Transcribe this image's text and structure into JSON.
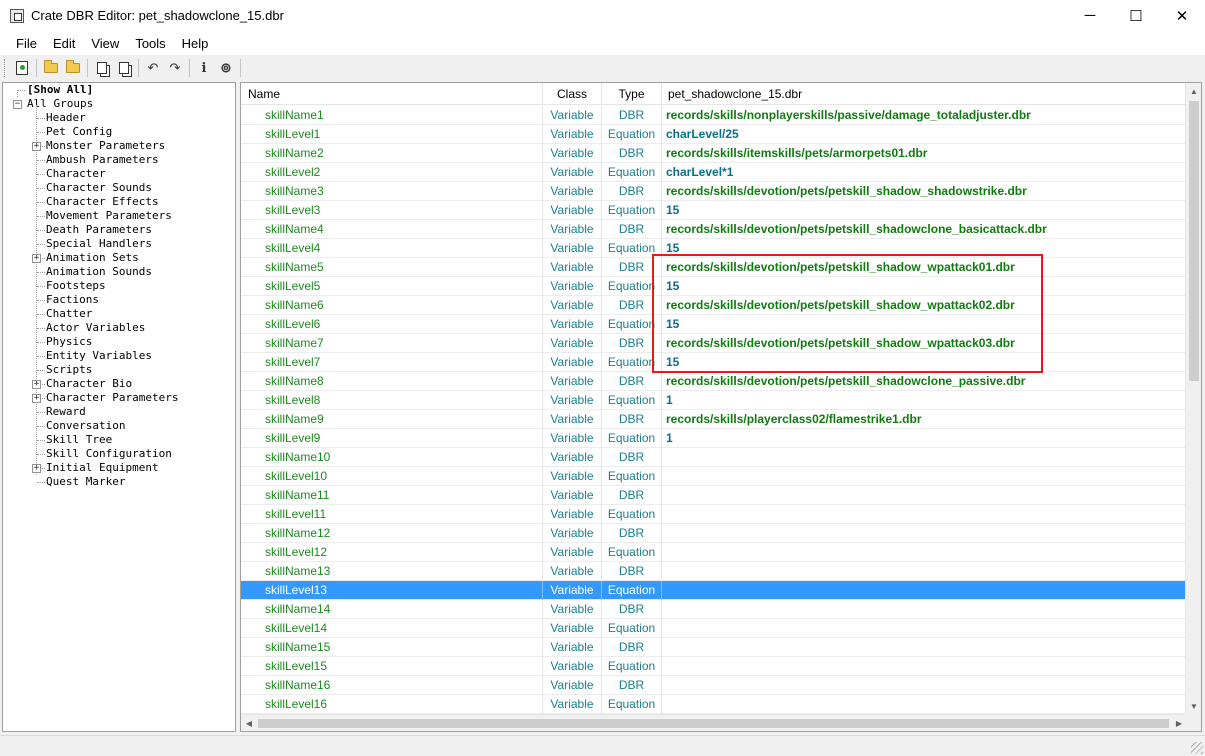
{
  "window": {
    "title": "Crate DBR Editor: pet_shadowclone_15.dbr",
    "minimize": "─",
    "maximize": "☐",
    "close": "✕"
  },
  "menu": [
    "File",
    "Edit",
    "View",
    "Tools",
    "Help"
  ],
  "tree": {
    "show_all": "[Show All]",
    "root": "All Groups",
    "items": [
      {
        "label": "Header",
        "expandable": false
      },
      {
        "label": "Pet Config",
        "expandable": false
      },
      {
        "label": "Monster Parameters",
        "expandable": true
      },
      {
        "label": "Ambush Parameters",
        "expandable": false
      },
      {
        "label": "Character",
        "expandable": false
      },
      {
        "label": "Character Sounds",
        "expandable": false
      },
      {
        "label": "Character Effects",
        "expandable": false
      },
      {
        "label": "Movement Parameters",
        "expandable": false
      },
      {
        "label": "Death Parameters",
        "expandable": false
      },
      {
        "label": "Special Handlers",
        "expandable": false
      },
      {
        "label": "Animation Sets",
        "expandable": true
      },
      {
        "label": "Animation Sounds",
        "expandable": false
      },
      {
        "label": "Footsteps",
        "expandable": false
      },
      {
        "label": "Factions",
        "expandable": false
      },
      {
        "label": "Chatter",
        "expandable": false
      },
      {
        "label": "Actor Variables",
        "expandable": false
      },
      {
        "label": "Physics",
        "expandable": false
      },
      {
        "label": "Entity Variables",
        "expandable": false
      },
      {
        "label": "Scripts",
        "expandable": false
      },
      {
        "label": "Character Bio",
        "expandable": true
      },
      {
        "label": "Character Parameters",
        "expandable": true
      },
      {
        "label": "Reward",
        "expandable": false
      },
      {
        "label": "Conversation",
        "expandable": false
      },
      {
        "label": "Skill Tree",
        "expandable": false
      },
      {
        "label": "Skill Configuration",
        "expandable": false
      },
      {
        "label": "Initial Equipment",
        "expandable": true
      },
      {
        "label": "Quest Marker",
        "expandable": false
      }
    ]
  },
  "grid": {
    "columns": {
      "name": "Name",
      "class": "Class",
      "type": "Type",
      "value": "pet_shadowclone_15.dbr"
    },
    "selected_index": 25,
    "rows": [
      {
        "name": "skillName1",
        "class": "Variable",
        "type": "DBR",
        "value": "records/skills/nonplayerskills/passive/damage_totaladjuster.dbr"
      },
      {
        "name": "skillLevel1",
        "class": "Variable",
        "type": "Equation",
        "value": "charLevel/25"
      },
      {
        "name": "skillName2",
        "class": "Variable",
        "type": "DBR",
        "value": "records/skills/itemskills/pets/armorpets01.dbr"
      },
      {
        "name": "skillLevel2",
        "class": "Variable",
        "type": "Equation",
        "value": "charLevel*1"
      },
      {
        "name": "skillName3",
        "class": "Variable",
        "type": "DBR",
        "value": "records/skills/devotion/pets/petskill_shadow_shadowstrike.dbr"
      },
      {
        "name": "skillLevel3",
        "class": "Variable",
        "type": "Equation",
        "value": "15"
      },
      {
        "name": "skillName4",
        "class": "Variable",
        "type": "DBR",
        "value": "records/skills/devotion/pets/petskill_shadowclone_basicattack.dbr"
      },
      {
        "name": "skillLevel4",
        "class": "Variable",
        "type": "Equation",
        "value": "15"
      },
      {
        "name": "skillName5",
        "class": "Variable",
        "type": "DBR",
        "value": "records/skills/devotion/pets/petskill_shadow_wpattack01.dbr"
      },
      {
        "name": "skillLevel5",
        "class": "Variable",
        "type": "Equation",
        "value": "15"
      },
      {
        "name": "skillName6",
        "class": "Variable",
        "type": "DBR",
        "value": "records/skills/devotion/pets/petskill_shadow_wpattack02.dbr"
      },
      {
        "name": "skillLevel6",
        "class": "Variable",
        "type": "Equation",
        "value": "15"
      },
      {
        "name": "skillName7",
        "class": "Variable",
        "type": "DBR",
        "value": "records/skills/devotion/pets/petskill_shadow_wpattack03.dbr"
      },
      {
        "name": "skillLevel7",
        "class": "Variable",
        "type": "Equation",
        "value": "15"
      },
      {
        "name": "skillName8",
        "class": "Variable",
        "type": "DBR",
        "value": "records/skills/devotion/pets/petskill_shadowclone_passive.dbr"
      },
      {
        "name": "skillLevel8",
        "class": "Variable",
        "type": "Equation",
        "value": "1"
      },
      {
        "name": "skillName9",
        "class": "Variable",
        "type": "DBR",
        "value": "records/skills/playerclass02/flamestrike1.dbr"
      },
      {
        "name": "skillLevel9",
        "class": "Variable",
        "type": "Equation",
        "value": "1"
      },
      {
        "name": "skillName10",
        "class": "Variable",
        "type": "DBR",
        "value": ""
      },
      {
        "name": "skillLevel10",
        "class": "Variable",
        "type": "Equation",
        "value": ""
      },
      {
        "name": "skillName11",
        "class": "Variable",
        "type": "DBR",
        "value": ""
      },
      {
        "name": "skillLevel11",
        "class": "Variable",
        "type": "Equation",
        "value": ""
      },
      {
        "name": "skillName12",
        "class": "Variable",
        "type": "DBR",
        "value": ""
      },
      {
        "name": "skillLevel12",
        "class": "Variable",
        "type": "Equation",
        "value": ""
      },
      {
        "name": "skillName13",
        "class": "Variable",
        "type": "DBR",
        "value": ""
      },
      {
        "name": "skillLevel13",
        "class": "Variable",
        "type": "Equation",
        "value": ""
      },
      {
        "name": "skillName14",
        "class": "Variable",
        "type": "DBR",
        "value": ""
      },
      {
        "name": "skillLevel14",
        "class": "Variable",
        "type": "Equation",
        "value": ""
      },
      {
        "name": "skillName15",
        "class": "Variable",
        "type": "DBR",
        "value": ""
      },
      {
        "name": "skillLevel15",
        "class": "Variable",
        "type": "Equation",
        "value": ""
      },
      {
        "name": "skillName16",
        "class": "Variable",
        "type": "DBR",
        "value": ""
      },
      {
        "name": "skillLevel16",
        "class": "Variable",
        "type": "Equation",
        "value": ""
      }
    ]
  },
  "colors": {
    "selection": "#3399ff",
    "name_text": "#1e8a1e",
    "dbr_value": "#107c10",
    "equation_value": "#0a6e8a",
    "highlight_box": "#e31b1b"
  }
}
